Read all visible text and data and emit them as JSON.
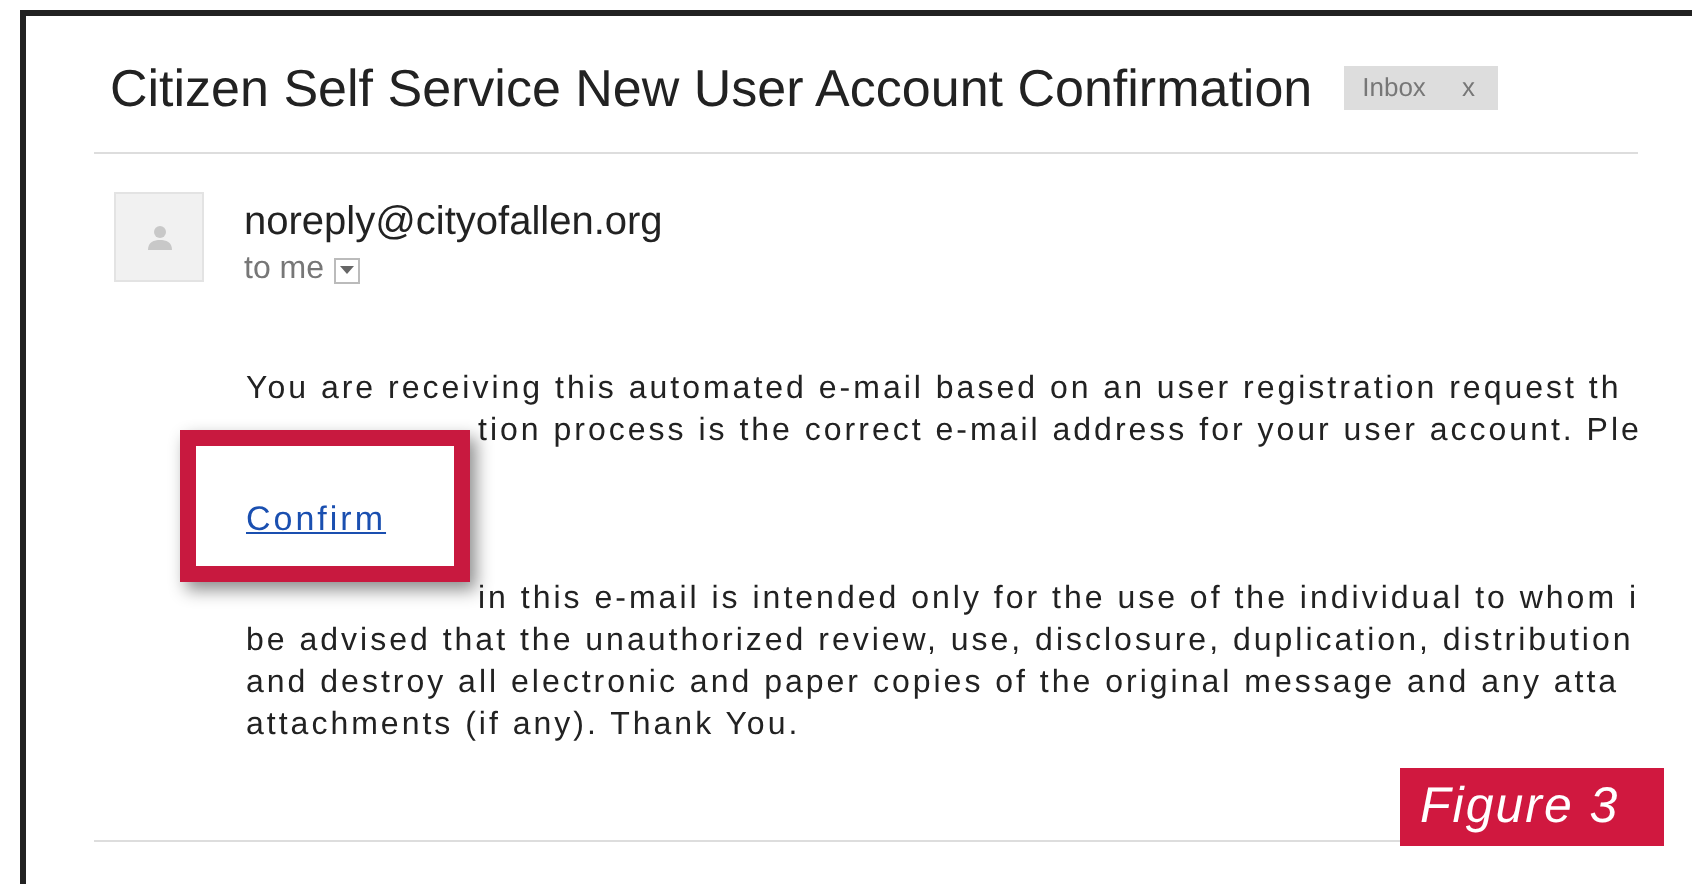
{
  "email": {
    "subject": "Citizen Self Service New User Account Confirmation",
    "label": {
      "text": "Inbox",
      "close": "x"
    },
    "sender": "noreply@cityofallen.org",
    "recipient": "to me",
    "body": [
      {
        "kind": "text",
        "text": "You are receiving this automated e-mail based on an user registration request th"
      },
      {
        "kind": "covered",
        "text": "tion process is the correct e-mail address for your user account. Ple"
      },
      {
        "kind": "link",
        "text": "Confirm",
        "highlighted": true
      },
      {
        "kind": "covered",
        "text": "in this e-mail is intended only for the use of the individual to whom i"
      },
      {
        "kind": "text",
        "text": "be advised that the unauthorized review, use, disclosure, duplication, distribution"
      },
      {
        "kind": "text",
        "text": "and destroy all electronic and paper copies of the original message and any atta"
      },
      {
        "kind": "text",
        "text": "attachments (if any). Thank You."
      }
    ]
  },
  "caption": "Figure 3"
}
